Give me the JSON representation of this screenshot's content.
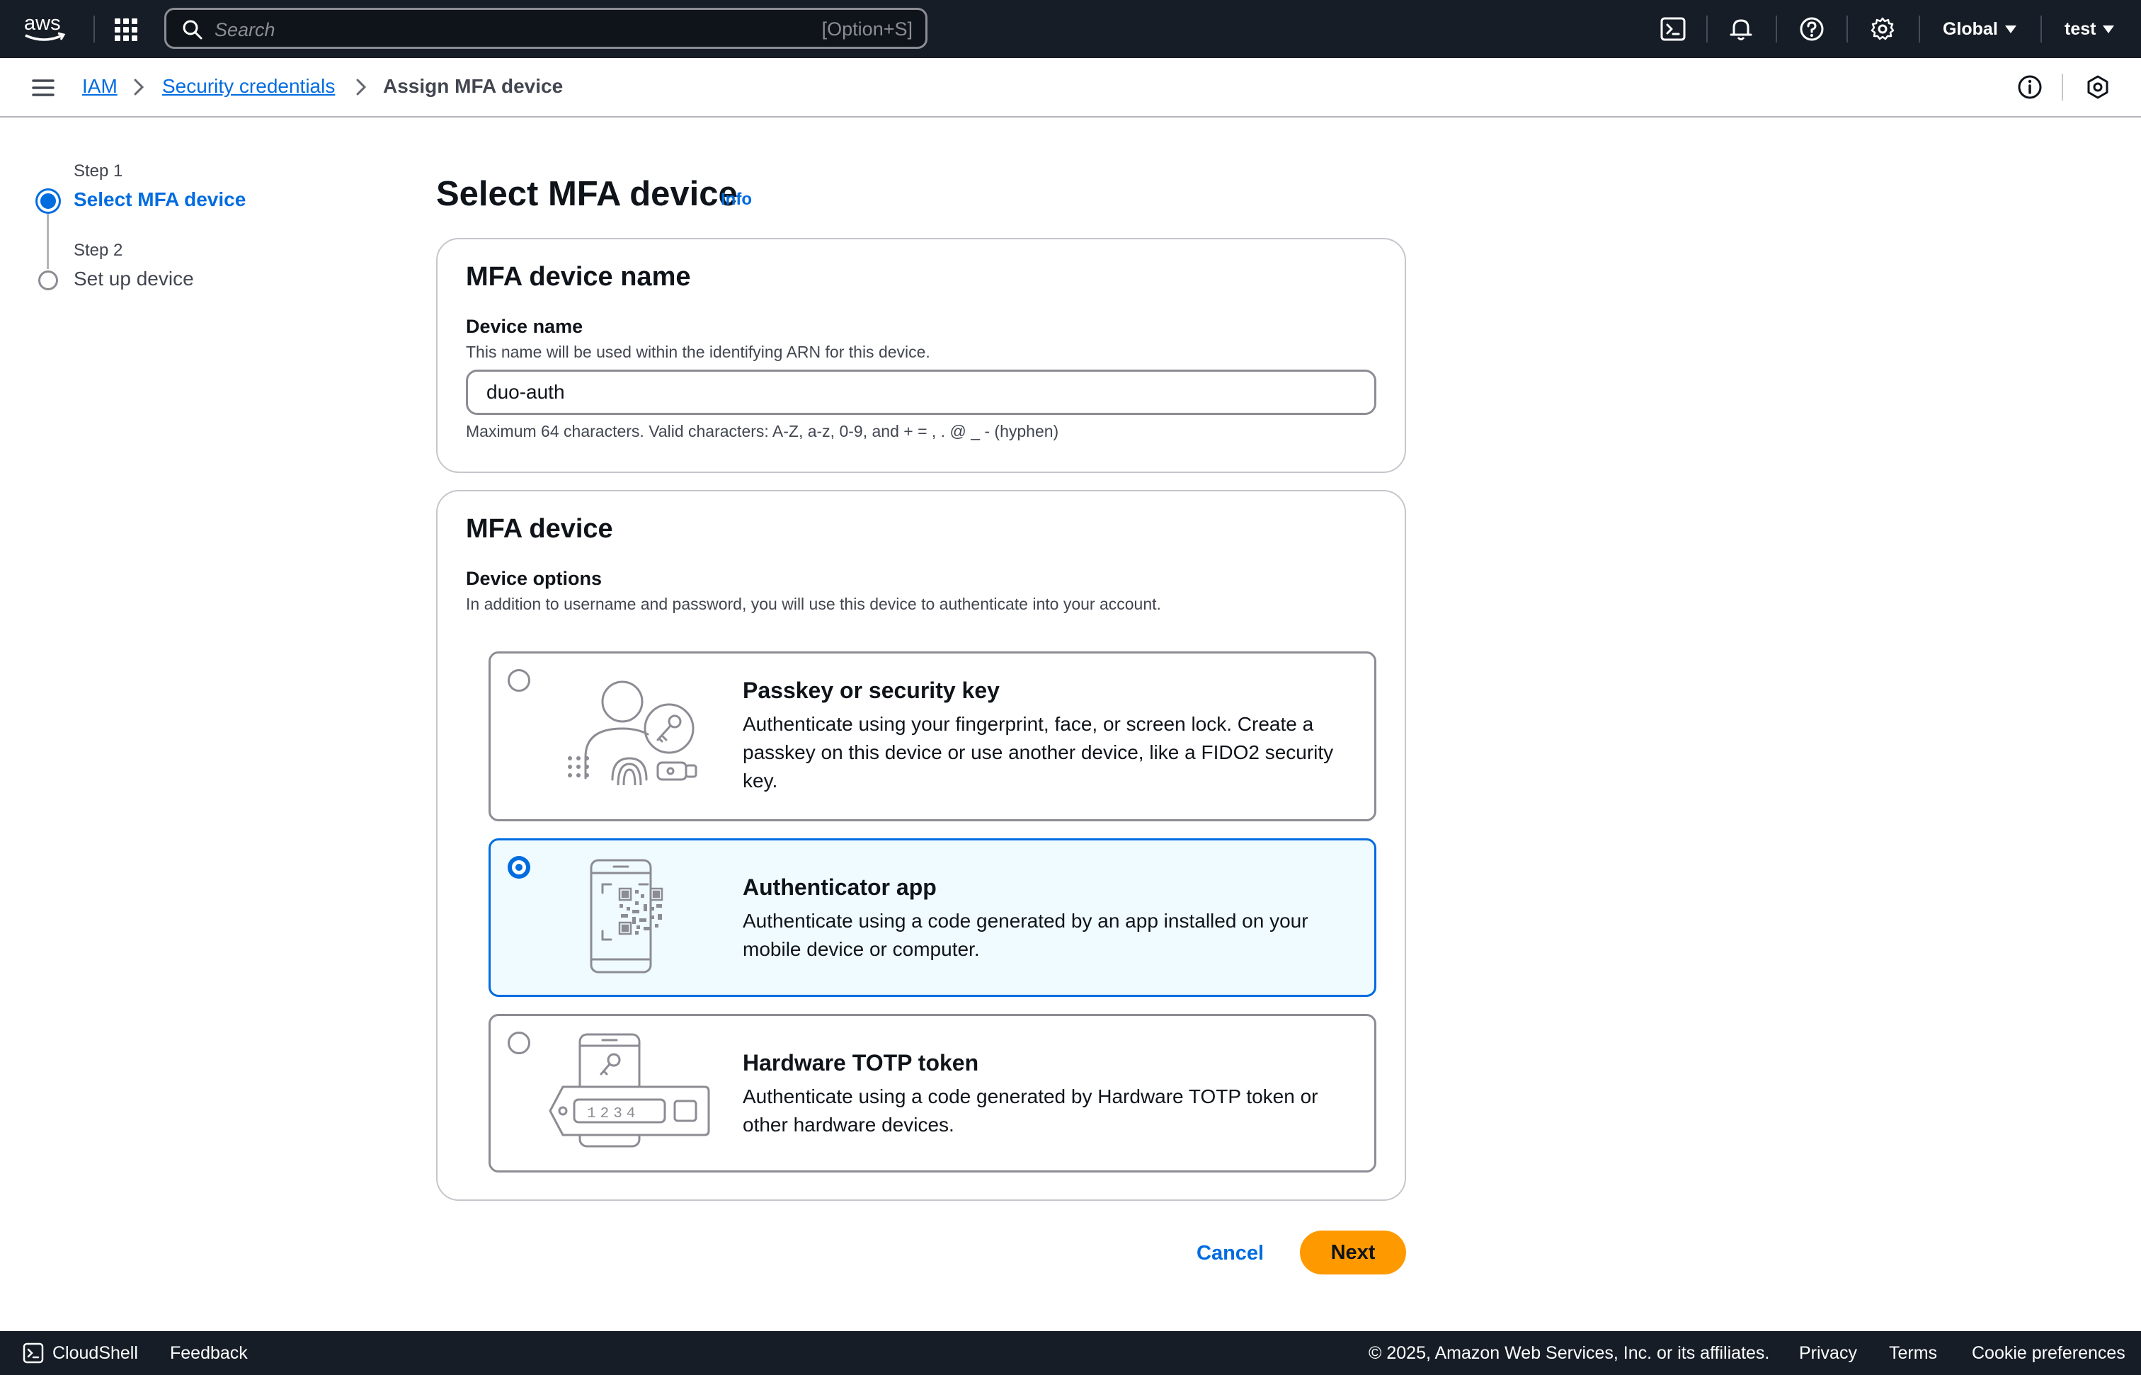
{
  "topnav": {
    "logo": "aws",
    "search_placeholder": "Search",
    "search_shortcut": "[Option+S]",
    "region": "Global",
    "account": "test",
    "icons": [
      "apps-grid-icon",
      "cloudshell-icon",
      "bell-icon",
      "help-icon",
      "settings-icon"
    ]
  },
  "breadcrumb": {
    "items": [
      "IAM",
      "Security credentials"
    ],
    "current": "Assign MFA device"
  },
  "steps": [
    {
      "caption": "Step 1",
      "title": "Select MFA device",
      "active": true
    },
    {
      "caption": "Step 2",
      "title": "Set up device",
      "active": false
    }
  ],
  "page": {
    "title": "Select MFA device",
    "info": "Info"
  },
  "device_name_section": {
    "heading": "MFA device name",
    "label": "Device name",
    "description": "This name will be used within the identifying ARN for this device.",
    "value": "duo-auth",
    "constraint": "Maximum 64 characters. Valid characters: A-Z, a-z, 0-9, and + = , . @ _ - (hyphen)"
  },
  "device_section": {
    "heading": "MFA device",
    "label": "Device options",
    "description": "In addition to username and password, you will use this device to authenticate into your account.",
    "options": [
      {
        "title": "Passkey or security key",
        "description": "Authenticate using your fingerprint, face, or screen lock. Create a passkey on this device or use another device, like a FIDO2 security key.",
        "selected": false
      },
      {
        "title": "Authenticator app",
        "description": "Authenticate using a code generated by an app installed on your mobile device or computer.",
        "selected": true
      },
      {
        "title": "Hardware TOTP token",
        "description": "Authenticate using a code generated by Hardware TOTP token or other hardware devices.",
        "selected": false,
        "token_display": "1234"
      }
    ]
  },
  "actions": {
    "cancel": "Cancel",
    "next": "Next"
  },
  "footer": {
    "cloudshell": "CloudShell",
    "feedback": "Feedback",
    "copyright": "© 2025, Amazon Web Services, Inc. or its affiliates.",
    "links": [
      "Privacy",
      "Terms",
      "Cookie preferences"
    ]
  },
  "colors": {
    "nav_bg": "#161d26",
    "link": "#006ce0",
    "primary_button": "#ff9900",
    "selected_tile_bg": "#f0fbff"
  }
}
